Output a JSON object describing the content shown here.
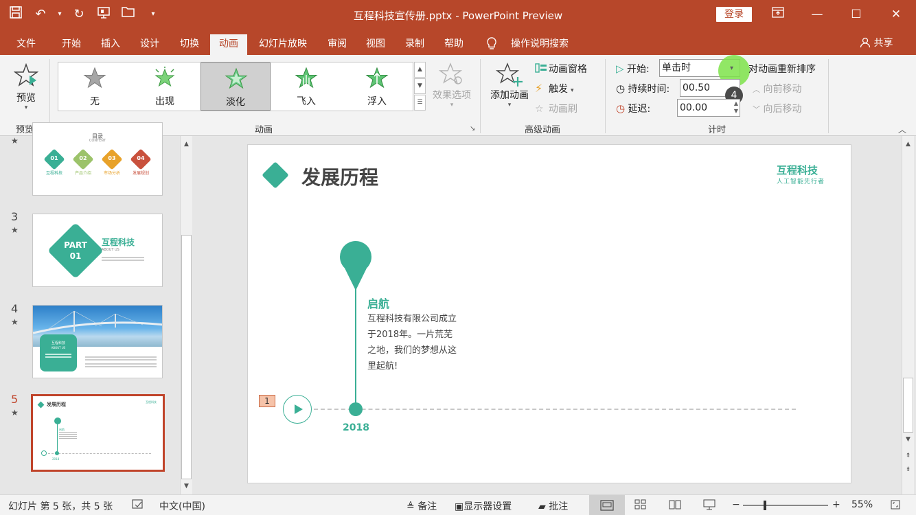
{
  "titlebar": {
    "title": "互程科技宣传册.pptx  -  PowerPoint Preview",
    "login_label": "登录",
    "qat_icons": [
      "save-icon",
      "undo-icon",
      "redo-icon",
      "present-from-start-icon",
      "open-folder-icon",
      "customize-icon"
    ]
  },
  "menu": {
    "tabs": [
      "文件",
      "开始",
      "插入",
      "设计",
      "切换",
      "动画",
      "幻灯片放映",
      "审阅",
      "视图",
      "录制",
      "帮助"
    ],
    "active_tab": "动画",
    "search_label": "操作说明搜索",
    "share_label": "共享"
  },
  "ribbon": {
    "preview": {
      "label": "预览",
      "group": "预览"
    },
    "animations": {
      "group": "动画",
      "items": [
        {
          "label": "无"
        },
        {
          "label": "出现"
        },
        {
          "label": "淡化"
        },
        {
          "label": "飞入"
        },
        {
          "label": "浮入"
        }
      ],
      "selected": "淡化",
      "effect_options": "效果选项"
    },
    "advanced": {
      "group": "高级动画",
      "add_animation": "添加动画",
      "animation_pane": "动画窗格",
      "trigger": "触发",
      "animation_painter": "动画刷"
    },
    "timing": {
      "group": "计时",
      "start_label": "开始:",
      "start_value": "单击时",
      "duration_label": "持续时间:",
      "duration_value": "00.50",
      "delay_label": "延迟:",
      "delay_value": "00.00",
      "reorder_label": "对动画重新排序",
      "move_earlier": "向前移动",
      "move_later": "向后移动",
      "step_badge": "4"
    }
  },
  "thumbnails": {
    "slide2": {
      "title": "目录",
      "subtitle": "CONTENT",
      "items": [
        {
          "num": "01",
          "label": "互程科技"
        },
        {
          "num": "02",
          "label": "产品介绍"
        },
        {
          "num": "03",
          "label": "市场分析"
        },
        {
          "num": "04",
          "label": "发展规划"
        }
      ]
    },
    "slide3": {
      "num": "3",
      "part": "PART",
      "part_num": "01",
      "title": "互程科技",
      "subtitle": "ABOUT US"
    },
    "slide4": {
      "num": "4",
      "box_title": "互程科技",
      "box_sub": "ABOUT US"
    },
    "slide5": {
      "num": "5",
      "title": "发展历程",
      "brand": "互程科技",
      "label": "启航",
      "year": "2018"
    }
  },
  "slide": {
    "title": "发展历程",
    "brand": "互程科技",
    "brand_sub": "人工智能先行者",
    "milestone_title": "启航",
    "milestone_lines": [
      "互程科技有限公司成立",
      "于2018年。一片荒芜",
      "之地，我们的梦想从这",
      "里起航!"
    ],
    "year": "2018",
    "anim_tag": "1"
  },
  "status": {
    "slide_info": "幻灯片 第 5 张，共 5 张",
    "language": "中文(中国)",
    "notes": "备注",
    "display_settings": "显示器设置",
    "comments": "批注",
    "zoom": "55%"
  },
  "colors": {
    "brand_red": "#b7472a",
    "teal": "#3aaf95",
    "highlight_green": "#7ee34b"
  }
}
